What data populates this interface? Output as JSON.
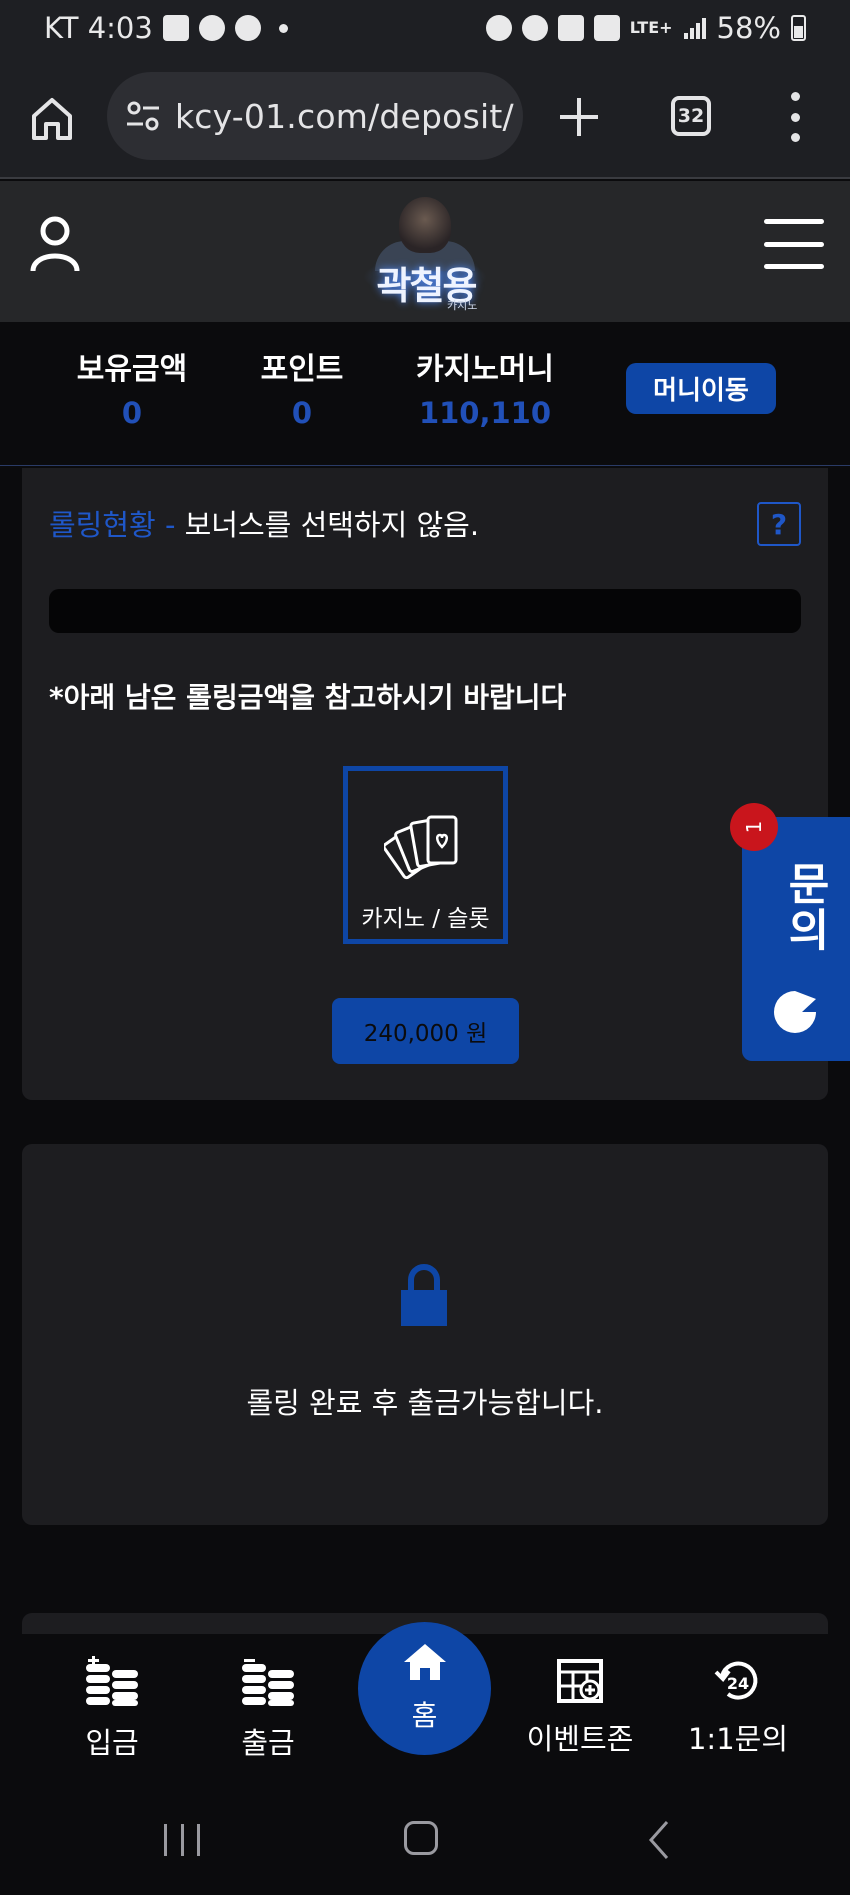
{
  "status_bar": {
    "carrier_time": "KT 4:03",
    "network": "LTE+",
    "battery": "58%"
  },
  "browser": {
    "url": "kcy-01.com/deposit/",
    "tab_count": "32"
  },
  "header": {
    "logo_text": "곽철용",
    "logo_subtext": "카지노"
  },
  "balances": [
    {
      "label": "보유금액",
      "value": "0"
    },
    {
      "label": "포인트",
      "value": "0"
    },
    {
      "label": "카지노머니",
      "value": "110,110"
    }
  ],
  "money_move_label": "머니이동",
  "rolling": {
    "title_prefix": "롤링현황 -",
    "title_status": "보너스를 선택하지 않음.",
    "help": "?",
    "note": "*아래 남은 롤링금액을 참고하시기 바랍니다",
    "game_label": "카지노 / 슬롯",
    "amount": "240,000 원"
  },
  "float_chat": {
    "label": "문의",
    "badge": "1"
  },
  "lock_card": {
    "message": "롤링 완료 후 출금가능합니다."
  },
  "bottom_nav": {
    "deposit": "입금",
    "withdraw": "출금",
    "home": "홈",
    "event": "이벤트존",
    "inquiry": "1:1문의"
  },
  "colors": {
    "accent": "#0e46a6",
    "accent_text": "#1f57c8",
    "card_bg": "#1d1d20",
    "page_bg": "#0b0b0d",
    "badge": "#c9151c"
  }
}
